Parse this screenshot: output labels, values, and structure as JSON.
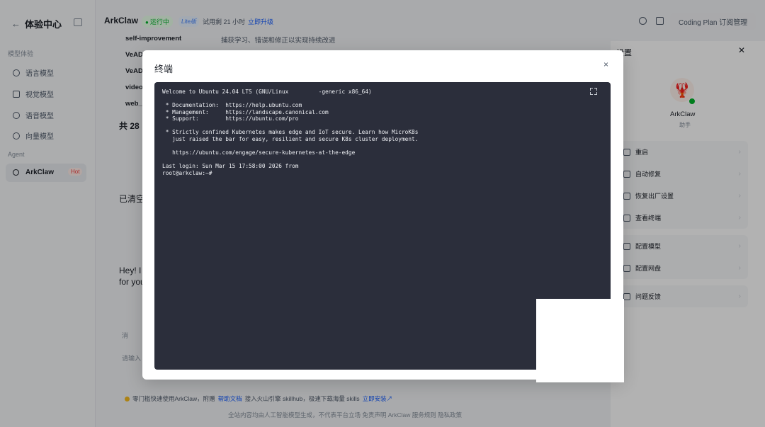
{
  "sidebar": {
    "back_icon": "←",
    "title": "体验中心",
    "section_models": "模型体验",
    "items": [
      {
        "label": "语言模型",
        "icon": "language-model-icon"
      },
      {
        "label": "视觉模型",
        "icon": "vision-model-icon"
      },
      {
        "label": "语音模型",
        "icon": "voice-model-icon"
      },
      {
        "label": "向量模型",
        "icon": "vector-model-icon"
      }
    ],
    "section_agent": "Agent",
    "agent_item": {
      "label": "ArkClaw",
      "badge": "Hot"
    }
  },
  "topbar": {
    "app_name": "ArkClaw",
    "status": "运行中",
    "plan_badge": "Lite版",
    "trial_text": "试用剩 21 小时",
    "upgrade_link": "立即升级",
    "coding_plan_button": "Coding Plan 订阅管理"
  },
  "background": {
    "skills": [
      {
        "name": "self-improvement",
        "desc": "捕获学习、错误和修正以实现持续改进"
      },
      {
        "name": "VeAD",
        "desc": ""
      },
      {
        "name": "VeAD",
        "desc": ""
      },
      {
        "name": "video",
        "desc": ""
      },
      {
        "name": "web_",
        "desc": ""
      }
    ],
    "total_prefix": "共 28",
    "cleared_text": "已清空",
    "greeting_line1": "Hey! I",
    "greeting_line2": "for you",
    "msg_label": "消",
    "input_placeholder": "请输入",
    "tip_prefix": "零门槛快速使用ArkClaw，附赠",
    "tip_doc_link": "帮助文档",
    "tip_middle": "接入火山引擎 skillhub，极速下载海量 skills",
    "tip_install_link": "立即安装↗",
    "footer": "全站内容均由人工智能模型生成，不代表平台立场   免责声明   ArkClaw 服务规则   隐私政策"
  },
  "right_panel": {
    "title": "设置",
    "close": "✕",
    "agent_name": "ArkClaw",
    "agent_sub": "助手",
    "group1": [
      "重启",
      "自动修复",
      "恢复出厂设置",
      "查看终端"
    ],
    "group2": [
      "配置模型",
      "配置网盘"
    ],
    "group3": [
      "问题反馈"
    ]
  },
  "modal": {
    "title": "终端",
    "close": "×",
    "terminal_lines": [
      "Welcome to Ubuntu 24.04 LTS (GNU/Linux         -generic x86_64)",
      "",
      " * Documentation:  https://help.ubuntu.com",
      " * Management:     https://landscape.canonical.com",
      " * Support:        https://ubuntu.com/pro",
      "",
      " * Strictly confined Kubernetes makes edge and IoT secure. Learn how MicroK8s",
      "   just raised the bar for easy, resilient and secure K8s cluster deployment.",
      "",
      "   https://ubuntu.com/engage/secure-kubernetes-at-the-edge",
      "",
      "Last login: Sun Mar 15 17:58:00 2026 from",
      "root@arkclaw:~#"
    ],
    "expand_icon": "fullscreen-icon"
  }
}
